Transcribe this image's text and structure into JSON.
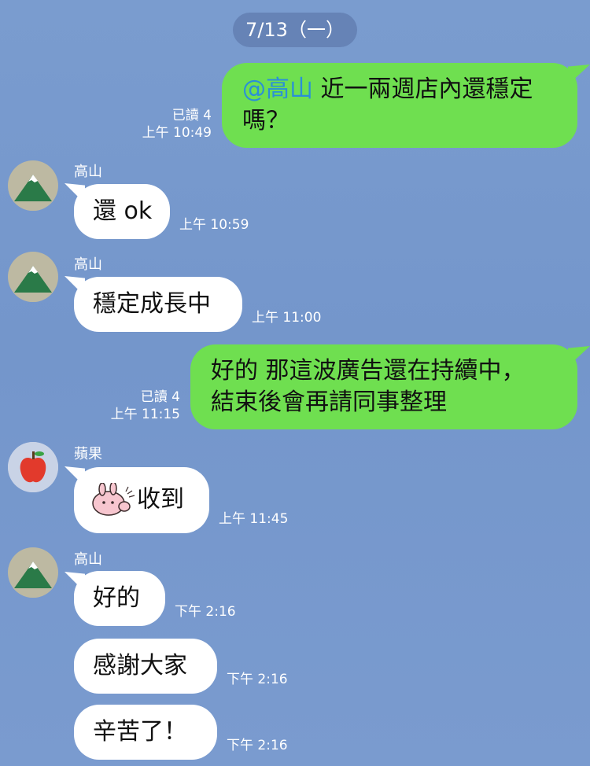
{
  "date_divider": "7/13（一）",
  "messages": [
    {
      "sender": "",
      "mention": "@高山",
      "text": "近一兩週店內還穩定",
      "text2": "嗎？",
      "read": "已讀 4",
      "time": "上午 10:49"
    },
    {
      "sender": "高山",
      "text": "還 ok",
      "time": "上午 10:59"
    },
    {
      "sender": "高山",
      "text": "穩定成長中",
      "time": "上午 11:00"
    },
    {
      "sender": "",
      "text": "好的  那這波廣告還在持續中，",
      "text2": "結束後會再請同事整理",
      "read": "已讀 4",
      "time": "上午 11:15"
    },
    {
      "sender": "蘋果",
      "text": "收到",
      "time": "上午 11:45"
    },
    {
      "sender": "高山",
      "text": "好的",
      "time": "下午 2:16"
    },
    {
      "sender": "",
      "text": "感謝大家",
      "time": "下午 2:16"
    },
    {
      "sender": "",
      "text": "辛苦了！",
      "time": "下午 2:16"
    }
  ],
  "colors": {
    "background": "#7a9ccf",
    "outgoing_bubble": "#6fdf50",
    "incoming_bubble": "#ffffff",
    "mention": "#2a8fd8"
  },
  "icons": {
    "gaoshan_avatar": "mountain-icon",
    "apple_avatar": "apple-icon",
    "sticker": "bunny-sticker-icon"
  }
}
